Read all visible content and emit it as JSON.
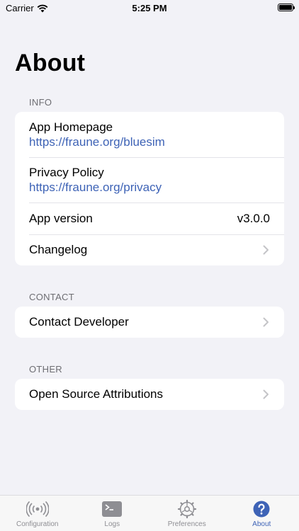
{
  "status_bar": {
    "carrier": "Carrier",
    "time": "5:25 PM"
  },
  "page": {
    "title": "About"
  },
  "sections": {
    "info": {
      "header": "INFO",
      "homepage": {
        "label": "App Homepage",
        "url": "https://fraune.org/bluesim"
      },
      "privacy": {
        "label": "Privacy Policy",
        "url": "https://fraune.org/privacy"
      },
      "version": {
        "label": "App version",
        "value": "v3.0.0"
      },
      "changelog": {
        "label": "Changelog"
      }
    },
    "contact": {
      "header": "CONTACT",
      "developer": {
        "label": "Contact Developer"
      }
    },
    "other": {
      "header": "OTHER",
      "attributions": {
        "label": "Open Source Attributions"
      }
    }
  },
  "tabs": [
    {
      "label": "Configuration",
      "icon": "antenna-icon",
      "active": false
    },
    {
      "label": "Logs",
      "icon": "terminal-icon",
      "active": false
    },
    {
      "label": "Preferences",
      "icon": "gear-icon",
      "active": false
    },
    {
      "label": "About",
      "icon": "question-icon",
      "active": true
    }
  ],
  "colors": {
    "accent": "#3e63b6",
    "background": "#f2f2f7",
    "inactive": "#8e8e93"
  }
}
